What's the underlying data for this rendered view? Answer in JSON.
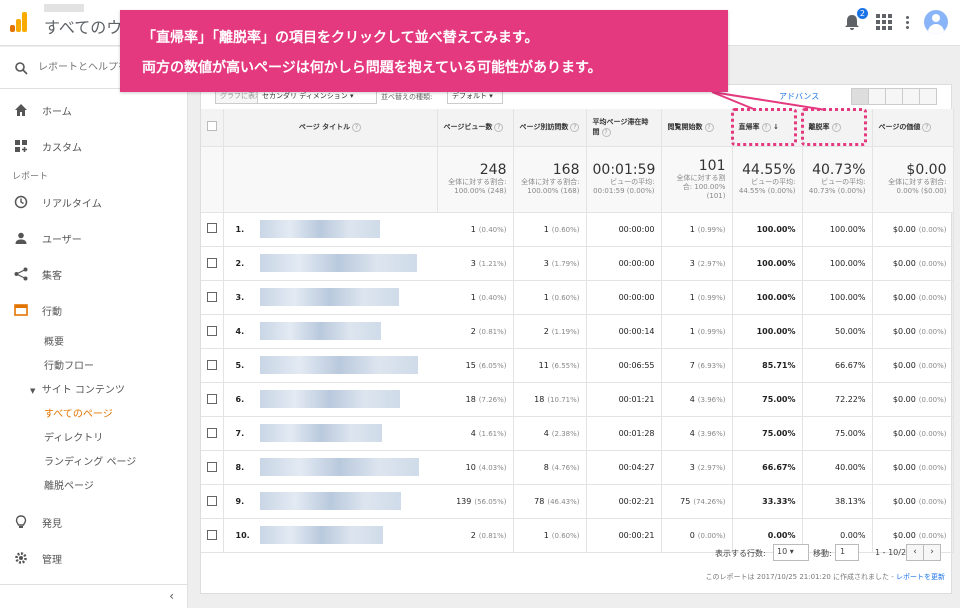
{
  "app": {
    "title": "すべてのウェ"
  },
  "topbar": {
    "notification_count": "2"
  },
  "search": {
    "placeholder": "レポートとヘルプを検索"
  },
  "sidebar": {
    "home": "ホーム",
    "custom": "カスタム",
    "reports_label": "レポート",
    "realtime": "リアルタイム",
    "users": "ユーザー",
    "acquisition": "集客",
    "behavior": "行動",
    "overview": "概要",
    "behavior_flow": "行動フロー",
    "site_content": "サイト コンテンツ",
    "all_pages": "すべてのページ",
    "directory": "ディレクトリ",
    "landing_pages": "ランディング ページ",
    "exit_pages": "離脱ページ",
    "discover": "発見",
    "admin": "管理",
    "collapse": "‹"
  },
  "controls": {
    "plot_rows": "グラフに表示",
    "secondary_dimension": "セカンダリ ディメンション",
    "sort_type_label": "並べ替えの種類:",
    "sort_type": "デフォルト",
    "advanced": "アドバンス"
  },
  "table": {
    "headers": {
      "page_title": "ページ タイトル",
      "pageviews": "ページビュー数",
      "unique_pageviews": "ページ別訪問数",
      "avg_time": "平均ページ滞在時間",
      "entrances": "閲覧開始数",
      "bounce_rate": "直帰率",
      "exit_rate": "離脱率",
      "page_value": "ページの価値",
      "help": "?",
      "sort_arrow": "↓"
    },
    "totals": {
      "pageviews": {
        "value": "248",
        "sub": "全体に対する割合: 100.00% (248)"
      },
      "unique_pageviews": {
        "value": "168",
        "sub": "全体に対する割合: 100.00% (168)"
      },
      "avg_time": {
        "value": "00:01:59",
        "sub": "ビューの平均: 00:01:59 (0.00%)"
      },
      "entrances": {
        "value": "101",
        "sub": "全体に対する割合: 100.00% (101)"
      },
      "bounce_rate": {
        "value": "44.55%",
        "sub": "ビューの平均: 44.55% (0.00%)"
      },
      "exit_rate": {
        "value": "40.73%",
        "sub": "ビューの平均: 40.73% (0.00%)"
      },
      "page_value": {
        "value": "$0.00",
        "sub": "全体に対する割合: 0.00% ($0.00)"
      }
    },
    "rows": [
      {
        "idx": "1.",
        "pv": "1",
        "pv_pct": "(0.40%)",
        "upv": "1",
        "upv_pct": "(0.60%)",
        "time": "00:00:00",
        "ent": "1",
        "ent_pct": "(0.99%)",
        "bounce": "100.00%",
        "exit": "100.00%",
        "val": "$0.00",
        "val_pct": "(0.00%)"
      },
      {
        "idx": "2.",
        "pv": "3",
        "pv_pct": "(1.21%)",
        "upv": "3",
        "upv_pct": "(1.79%)",
        "time": "00:00:00",
        "ent": "3",
        "ent_pct": "(2.97%)",
        "bounce": "100.00%",
        "exit": "100.00%",
        "val": "$0.00",
        "val_pct": "(0.00%)"
      },
      {
        "idx": "3.",
        "pv": "1",
        "pv_pct": "(0.40%)",
        "upv": "1",
        "upv_pct": "(0.60%)",
        "time": "00:00:00",
        "ent": "1",
        "ent_pct": "(0.99%)",
        "bounce": "100.00%",
        "exit": "100.00%",
        "val": "$0.00",
        "val_pct": "(0.00%)"
      },
      {
        "idx": "4.",
        "pv": "2",
        "pv_pct": "(0.81%)",
        "upv": "2",
        "upv_pct": "(1.19%)",
        "time": "00:00:14",
        "ent": "1",
        "ent_pct": "(0.99%)",
        "bounce": "100.00%",
        "exit": "50.00%",
        "val": "$0.00",
        "val_pct": "(0.00%)"
      },
      {
        "idx": "5.",
        "pv": "15",
        "pv_pct": "(6.05%)",
        "upv": "11",
        "upv_pct": "(6.55%)",
        "time": "00:06:55",
        "ent": "7",
        "ent_pct": "(6.93%)",
        "bounce": "85.71%",
        "exit": "66.67%",
        "val": "$0.00",
        "val_pct": "(0.00%)"
      },
      {
        "idx": "6.",
        "pv": "18",
        "pv_pct": "(7.26%)",
        "upv": "18",
        "upv_pct": "(10.71%)",
        "time": "00:01:21",
        "ent": "4",
        "ent_pct": "(3.96%)",
        "bounce": "75.00%",
        "exit": "72.22%",
        "val": "$0.00",
        "val_pct": "(0.00%)"
      },
      {
        "idx": "7.",
        "pv": "4",
        "pv_pct": "(1.61%)",
        "upv": "4",
        "upv_pct": "(2.38%)",
        "time": "00:01:28",
        "ent": "4",
        "ent_pct": "(3.96%)",
        "bounce": "75.00%",
        "exit": "75.00%",
        "val": "$0.00",
        "val_pct": "(0.00%)"
      },
      {
        "idx": "8.",
        "pv": "10",
        "pv_pct": "(4.03%)",
        "upv": "8",
        "upv_pct": "(4.76%)",
        "time": "00:04:27",
        "ent": "3",
        "ent_pct": "(2.97%)",
        "bounce": "66.67%",
        "exit": "40.00%",
        "val": "$0.00",
        "val_pct": "(0.00%)"
      },
      {
        "idx": "9.",
        "pv": "139",
        "pv_pct": "(56.05%)",
        "upv": "78",
        "upv_pct": "(46.43%)",
        "time": "00:02:21",
        "ent": "75",
        "ent_pct": "(74.26%)",
        "bounce": "33.33%",
        "exit": "38.13%",
        "val": "$0.00",
        "val_pct": "(0.00%)"
      },
      {
        "idx": "10.",
        "pv": "2",
        "pv_pct": "(0.81%)",
        "upv": "1",
        "upv_pct": "(0.60%)",
        "time": "00:00:21",
        "ent": "0",
        "ent_pct": "(0.00%)",
        "bounce": "0.00%",
        "exit": "0.00%",
        "val": "$0.00",
        "val_pct": "(0.00%)"
      }
    ]
  },
  "footer": {
    "rows_label": "表示する行数:",
    "rows_value": "10",
    "goto_label": "移動:",
    "goto_value": "1",
    "range": "1 - 10/27",
    "prev": "‹",
    "next": "›",
    "report_info": "このレポートは 2017/10/25 21:01:20 に作成されました -",
    "refresh": "レポートを更新"
  },
  "callout": {
    "line1": "「直帰率」「離脱率」の項目をクリックして並べ替えてみます。",
    "line2": "両方の数値が高いページは何かしら問題を抱えている可能性があります。"
  },
  "colors": {
    "accent": "#e4397f",
    "brand_orange": "#e37400",
    "link": "#1a73e8"
  }
}
